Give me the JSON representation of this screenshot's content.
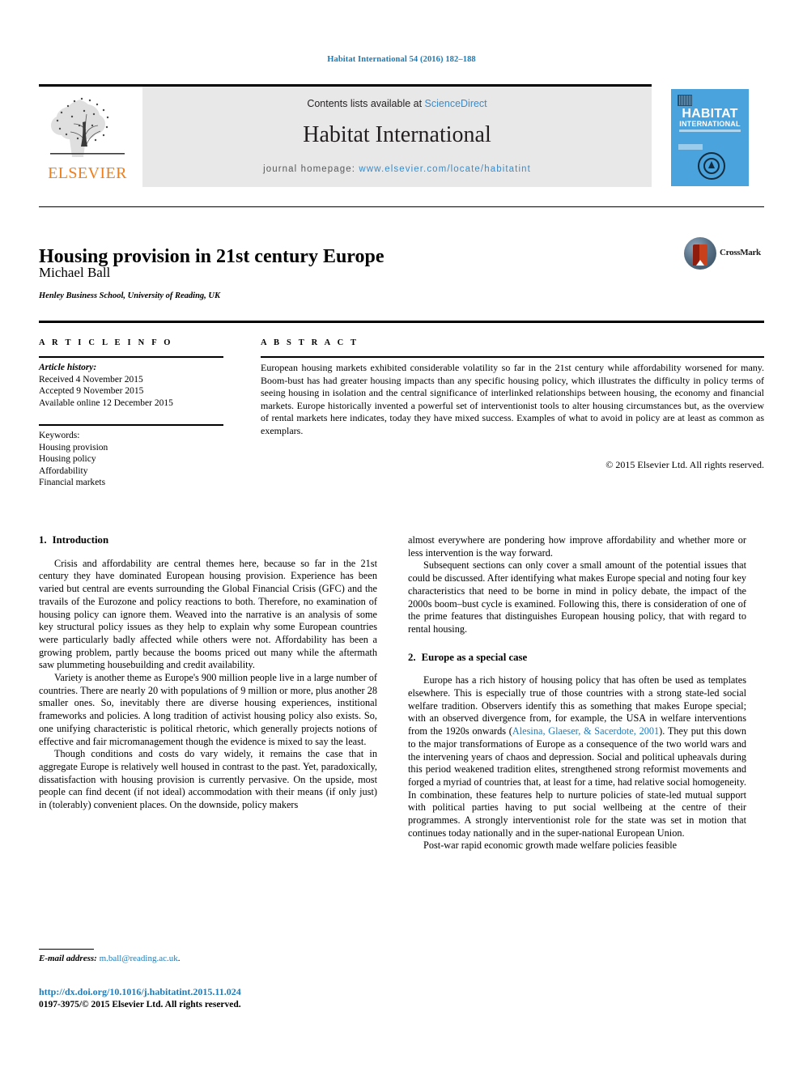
{
  "running_head": "Habitat International 54 (2016) 182–188",
  "masthead": {
    "contents_prefix": "Contents lists available at ",
    "sciencedirect": "ScienceDirect",
    "journal_title": "Habitat International",
    "homepage_prefix": "journal homepage: ",
    "homepage_url": "www.elsevier.com/locate/habitatint",
    "publisher_logo_text": "ELSEVIER",
    "cover_title_line1": "HABITAT",
    "cover_title_line2": "INTERNATIONAL"
  },
  "article": {
    "title": "Housing provision in 21st century Europe",
    "author": "Michael Ball",
    "affiliation": "Henley Business School, University of Reading, UK",
    "crossmark_label": "CrossMark"
  },
  "info": {
    "heading": "A R T I C L E   I N F O",
    "history_label": "Article history:",
    "received": "Received 4 November 2015",
    "accepted": "Accepted 9 November 2015",
    "available": "Available online 12 December 2015",
    "keywords_label": "Keywords:",
    "keywords": [
      "Housing provision",
      "Housing policy",
      "Affordability",
      "Financial markets"
    ]
  },
  "abstract": {
    "heading": "A B S T R A C T",
    "text": "European housing markets exhibited considerable volatility so far in the 21st century while affordability worsened for many. Boom-bust has had greater housing impacts than any specific housing policy, which illustrates the difficulty in policy terms of seeing housing in isolation and the central significance of interlinked relationships between housing, the economy and financial markets. Europe historically invented a powerful set of interventionist tools to alter housing circumstances but, as the overview of rental markets here indicates, today they have mixed success. Examples of what to avoid in policy are at least as common as exemplars.",
    "copyright": "© 2015 Elsevier Ltd. All rights reserved."
  },
  "body": {
    "section1_number": "1.",
    "section1_title": "Introduction",
    "s1_p1": "Crisis and affordability are central themes here, because so far in the 21st century they have dominated European housing provision. Experience has been varied but central are events surrounding the Global Financial Crisis (GFC) and the travails of the Eurozone and policy reactions to both. Therefore, no examination of housing policy can ignore them. Weaved into the narrative is an analysis of some key structural policy issues as they help to explain why some European countries were particularly badly affected while others were not. Affordability has been a growing problem, partly because the booms priced out many while the aftermath saw plummeting housebuilding and credit availability.",
    "s1_p2": "Variety is another theme as Europe's 900 million people live in a large number of countries. There are nearly 20 with populations of 9 million or more, plus another 28 smaller ones. So, inevitably there are diverse housing experiences, institional frameworks and policies. A long tradition of activist housing policy also exists. So, one unifying characteristic is political rhetoric, which generally projects notions of effective and fair micromanagement though the evidence is mixed to say the least.",
    "s1_p3": "Though conditions and costs do vary widely, it remains the case that in aggregate Europe is relatively well housed in contrast to the past. Yet, paradoxically, dissatisfaction with housing provision is currently pervasive. On the upside, most people can find decent (if not ideal) accommodation with their means (if only just) in (tolerably) convenient places. On the downside, policy makers",
    "s1_p3_cont": "almost everywhere are pondering how improve affordability and whether more or less intervention is the way forward.",
    "s1_p4": "Subsequent sections can only cover a small amount of the potential issues that could be discussed. After identifying what makes Europe special and noting four key characteristics that need to be borne in mind in policy debate, the impact of the 2000s boom–bust cycle is examined. Following this, there is consideration of one of the prime features that distinguishes European housing policy, that with regard to rental housing.",
    "section2_number": "2.",
    "section2_title": "Europe as a special case",
    "s2_p1_a": "Europe has a rich history of housing policy that has often be used as templates elsewhere. This is especially true of those countries with a strong state-led social welfare tradition. Observers identify this as something that makes Europe special; with an observed divergence from, for example, the USA in welfare interventions from the 1920s onwards (",
    "s2_p1_ref": "Alesina, Glaeser, & Sacerdote, 2001",
    "s2_p1_b": "). They put this down to the major transformations of Europe as a consequence of the two world wars and the intervening years of chaos and depression. Social and political upheavals during this period weakened tradition elites, strengthened strong reformist movements and forged a myriad of countries that, at least for a time, had relative social homogeneity. In combination, these features help to nurture policies of state-led mutual support with political parties having to put social wellbeing at the centre of their programmes. A strongly interventionist role for the state was set in motion that continues today nationally and in the super-national European Union.",
    "s2_p2": "Post-war rapid economic growth made welfare policies feasible"
  },
  "footer": {
    "email_label": "E-mail address:",
    "email": "m.ball@reading.ac.uk",
    "doi": "http://dx.doi.org/10.1016/j.habitatint.2015.11.024",
    "issn": "0197-3975/© 2015 Elsevier Ltd. All rights reserved."
  },
  "colors": {
    "link_blue": "#1f7bb6",
    "sciencedirect_blue": "#3b8bc9",
    "elsevier_orange": "#f07f1a",
    "cover_blue": "#4aa3dd",
    "masthead_grey": "#e8e8e8"
  }
}
